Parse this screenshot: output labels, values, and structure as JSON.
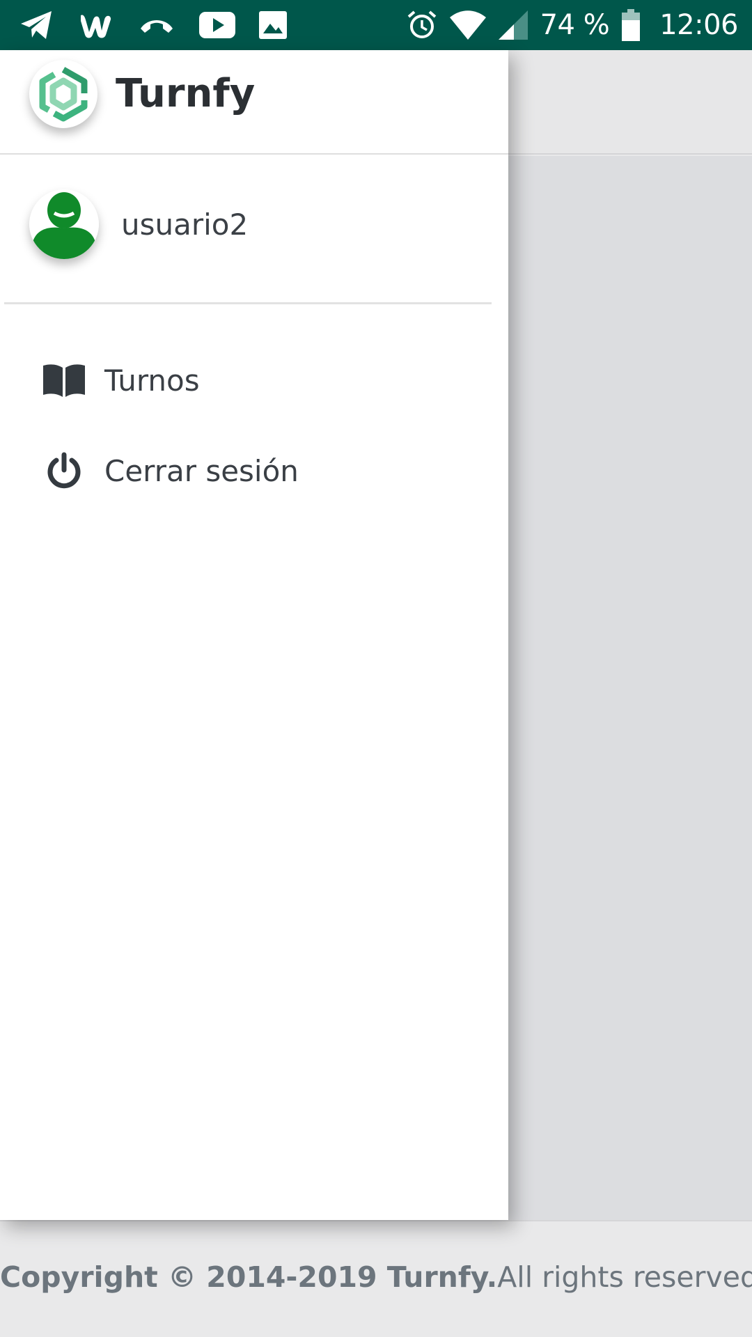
{
  "status_bar": {
    "battery": "74 %",
    "time": "12:06",
    "left_icons": [
      "telegram-icon",
      "wattpad-icon",
      "missed-call-icon",
      "youtube-icon",
      "gallery-icon"
    ],
    "right_icons": [
      "alarm-icon",
      "wifi-icon",
      "signal-icon",
      "battery-icon"
    ],
    "background": "#00574b"
  },
  "drawer": {
    "brand_name": "Turnfy",
    "user_name": "usuario2",
    "menu": [
      {
        "label": "Turnos",
        "icon": "book-icon"
      },
      {
        "label": "Cerrar sesión",
        "icon": "power-icon"
      }
    ]
  },
  "footer": {
    "copyright_bold": "Copyright © 2014-2019 Turnfy.",
    "copyright_rest": "All rights reserved."
  },
  "colors": {
    "brand_green": "#3aa57a",
    "avatar_green": "#108a2a",
    "text_dark": "#343a40",
    "footer_text": "#6c757d"
  }
}
